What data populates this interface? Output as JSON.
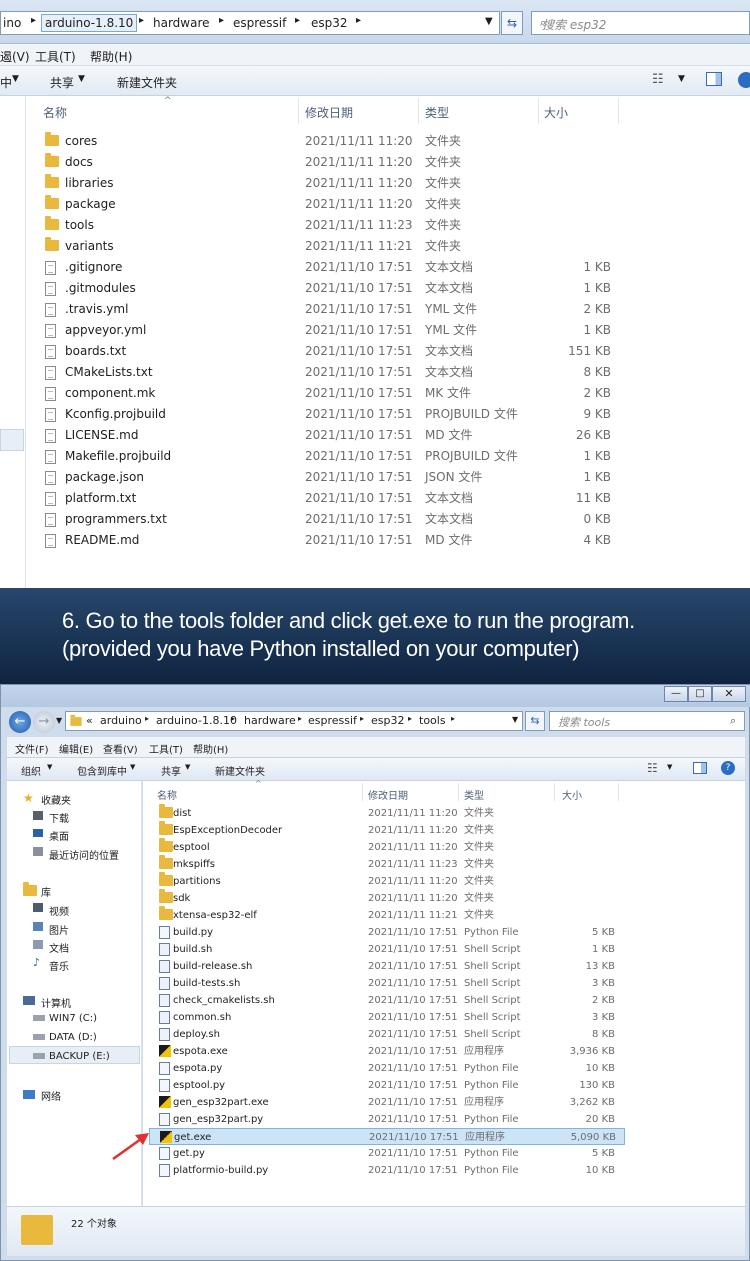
{
  "top_window": {
    "breadcrumbs": [
      "ino",
      "arduino-1.8.10",
      "hardware",
      "espressif",
      "esp32"
    ],
    "search_placeholder": "搜索 esp32",
    "menu": [
      "遏(V)",
      "工具(T)",
      "帮助(H)"
    ],
    "toolbar": {
      "left_clip": "中",
      "share": "共享",
      "new_folder": "新建文件夹"
    },
    "columns": {
      "name": "名称",
      "date": "修改日期",
      "type": "类型",
      "size": "大小"
    },
    "files": [
      {
        "name": "cores",
        "date": "2021/11/11 11:20",
        "type": "文件夹",
        "size": "",
        "icon": "folder"
      },
      {
        "name": "docs",
        "date": "2021/11/11 11:20",
        "type": "文件夹",
        "size": "",
        "icon": "folder"
      },
      {
        "name": "libraries",
        "date": "2021/11/11 11:20",
        "type": "文件夹",
        "size": "",
        "icon": "folder"
      },
      {
        "name": "package",
        "date": "2021/11/11 11:20",
        "type": "文件夹",
        "size": "",
        "icon": "folder"
      },
      {
        "name": "tools",
        "date": "2021/11/11 11:23",
        "type": "文件夹",
        "size": "",
        "icon": "folder"
      },
      {
        "name": "variants",
        "date": "2021/11/11 11:21",
        "type": "文件夹",
        "size": "",
        "icon": "folder"
      },
      {
        "name": ".gitignore",
        "date": "2021/11/10 17:51",
        "type": "文本文档",
        "size": "1 KB",
        "icon": "doc"
      },
      {
        "name": ".gitmodules",
        "date": "2021/11/10 17:51",
        "type": "文本文档",
        "size": "1 KB",
        "icon": "doc"
      },
      {
        "name": ".travis.yml",
        "date": "2021/11/10 17:51",
        "type": "YML 文件",
        "size": "2 KB",
        "icon": "doc"
      },
      {
        "name": "appveyor.yml",
        "date": "2021/11/10 17:51",
        "type": "YML 文件",
        "size": "1 KB",
        "icon": "doc"
      },
      {
        "name": "boards.txt",
        "date": "2021/11/10 17:51",
        "type": "文本文档",
        "size": "151 KB",
        "icon": "doc"
      },
      {
        "name": "CMakeLists.txt",
        "date": "2021/11/10 17:51",
        "type": "文本文档",
        "size": "8 KB",
        "icon": "doc"
      },
      {
        "name": "component.mk",
        "date": "2021/11/10 17:51",
        "type": "MK 文件",
        "size": "2 KB",
        "icon": "doc"
      },
      {
        "name": "Kconfig.projbuild",
        "date": "2021/11/10 17:51",
        "type": "PROJBUILD 文件",
        "size": "9 KB",
        "icon": "doc"
      },
      {
        "name": "LICENSE.md",
        "date": "2021/11/10 17:51",
        "type": "MD 文件",
        "size": "26 KB",
        "icon": "doc"
      },
      {
        "name": "Makefile.projbuild",
        "date": "2021/11/10 17:51",
        "type": "PROJBUILD 文件",
        "size": "1 KB",
        "icon": "doc"
      },
      {
        "name": "package.json",
        "date": "2021/11/10 17:51",
        "type": "JSON 文件",
        "size": "1 KB",
        "icon": "doc"
      },
      {
        "name": "platform.txt",
        "date": "2021/11/10 17:51",
        "type": "文本文档",
        "size": "11 KB",
        "icon": "doc"
      },
      {
        "name": "programmers.txt",
        "date": "2021/11/10 17:51",
        "type": "文本文档",
        "size": "0 KB",
        "icon": "doc"
      },
      {
        "name": "README.md",
        "date": "2021/11/10 17:51",
        "type": "MD 文件",
        "size": "4 KB",
        "icon": "doc"
      }
    ]
  },
  "banner": {
    "line1": "6. Go to the tools folder and click get.exe to run the program.",
    "line2": "(provided you have Python installed on your computer)",
    "bg": "#17304f"
  },
  "bottom_window": {
    "breadcrumbs": [
      "«",
      "arduino",
      "arduino-1.8.10",
      "hardware",
      "espressif",
      "esp32",
      "tools"
    ],
    "search_placeholder": "搜索 tools",
    "menu": [
      "文件(F)",
      "编辑(E)",
      "查看(V)",
      "工具(T)",
      "帮助(H)"
    ],
    "toolbar": {
      "organize": "组织",
      "include": "包含到库中",
      "share": "共享",
      "new_folder": "新建文件夹"
    },
    "columns": {
      "name": "名称",
      "date": "修改日期",
      "type": "类型",
      "size": "大小"
    },
    "nav": {
      "favorites": "收藏夹",
      "downloads": "下载",
      "desktop": "桌面",
      "recent": "最近访问的位置",
      "libraries": "库",
      "videos": "视频",
      "pictures": "图片",
      "documents": "文档",
      "music": "音乐",
      "computer": "计算机",
      "drive_c": "WIN7 (C:)",
      "drive_d": "DATA (D:)",
      "drive_e": "BACKUP (E:)",
      "network": "网络"
    },
    "files": [
      {
        "name": "dist",
        "date": "2021/11/11 11:20",
        "type": "文件夹",
        "size": "",
        "icon": "folder"
      },
      {
        "name": "EspExceptionDecoder",
        "date": "2021/11/11 11:20",
        "type": "文件夹",
        "size": "",
        "icon": "folder"
      },
      {
        "name": "esptool",
        "date": "2021/11/11 11:20",
        "type": "文件夹",
        "size": "",
        "icon": "folder"
      },
      {
        "name": "mkspiffs",
        "date": "2021/11/11 11:23",
        "type": "文件夹",
        "size": "",
        "icon": "folder"
      },
      {
        "name": "partitions",
        "date": "2021/11/11 11:20",
        "type": "文件夹",
        "size": "",
        "icon": "folder"
      },
      {
        "name": "sdk",
        "date": "2021/11/11 11:20",
        "type": "文件夹",
        "size": "",
        "icon": "folder"
      },
      {
        "name": "xtensa-esp32-elf",
        "date": "2021/11/11 11:21",
        "type": "文件夹",
        "size": "",
        "icon": "folder"
      },
      {
        "name": "build.py",
        "date": "2021/11/10 17:51",
        "type": "Python File",
        "size": "5 KB",
        "icon": "py"
      },
      {
        "name": "build.sh",
        "date": "2021/11/10 17:51",
        "type": "Shell Script",
        "size": "1 KB",
        "icon": "sh"
      },
      {
        "name": "build-release.sh",
        "date": "2021/11/10 17:51",
        "type": "Shell Script",
        "size": "13 KB",
        "icon": "sh"
      },
      {
        "name": "build-tests.sh",
        "date": "2021/11/10 17:51",
        "type": "Shell Script",
        "size": "3 KB",
        "icon": "sh"
      },
      {
        "name": "check_cmakelists.sh",
        "date": "2021/11/10 17:51",
        "type": "Shell Script",
        "size": "2 KB",
        "icon": "sh"
      },
      {
        "name": "common.sh",
        "date": "2021/11/10 17:51",
        "type": "Shell Script",
        "size": "3 KB",
        "icon": "sh"
      },
      {
        "name": "deploy.sh",
        "date": "2021/11/10 17:51",
        "type": "Shell Script",
        "size": "8 KB",
        "icon": "sh"
      },
      {
        "name": "espota.exe",
        "date": "2021/11/10 17:51",
        "type": "应用程序",
        "size": "3,936 KB",
        "icon": "exe"
      },
      {
        "name": "espota.py",
        "date": "2021/11/10 17:51",
        "type": "Python File",
        "size": "10 KB",
        "icon": "py"
      },
      {
        "name": "esptool.py",
        "date": "2021/11/10 17:51",
        "type": "Python File",
        "size": "130 KB",
        "icon": "py"
      },
      {
        "name": "gen_esp32part.exe",
        "date": "2021/11/10 17:51",
        "type": "应用程序",
        "size": "3,262 KB",
        "icon": "exe"
      },
      {
        "name": "gen_esp32part.py",
        "date": "2021/11/10 17:51",
        "type": "Python File",
        "size": "20 KB",
        "icon": "py"
      },
      {
        "name": "get.exe",
        "date": "2021/11/10 17:51",
        "type": "应用程序",
        "size": "5,090 KB",
        "icon": "exe",
        "selected": true
      },
      {
        "name": "get.py",
        "date": "2021/11/10 17:51",
        "type": "Python File",
        "size": "5 KB",
        "icon": "py"
      },
      {
        "name": "platformio-build.py",
        "date": "2021/11/10 17:51",
        "type": "Python File",
        "size": "10 KB",
        "icon": "py"
      }
    ],
    "status": "22 个对象",
    "highlight_color": "#cde4f7",
    "arrow_color": "#e03030"
  }
}
